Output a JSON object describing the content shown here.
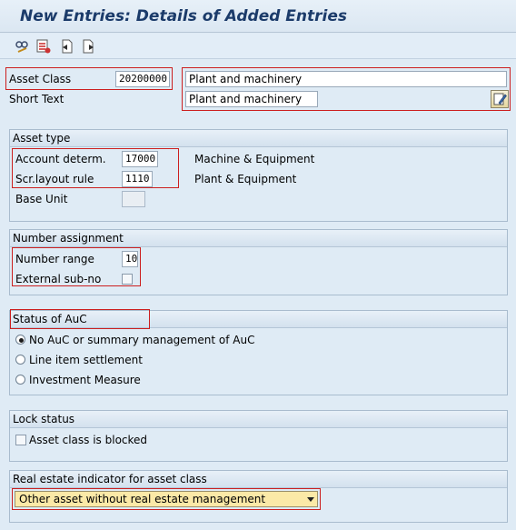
{
  "window": {
    "title": "New Entries: Details of Added Entries"
  },
  "toolbar": {
    "icons": [
      "display-change-icon",
      "delete-icon",
      "previous-entry-icon",
      "next-entry-icon"
    ]
  },
  "header": {
    "asset_class_label": "Asset Class",
    "asset_class_value": "20200000",
    "asset_class_desc": "Plant and machinery",
    "short_text_label": "Short Text",
    "short_text_value": "Plant and machinery"
  },
  "asset_type": {
    "title": "Asset type",
    "account_determ_label": "Account determ.",
    "account_determ_value": "17000",
    "account_determ_desc": "Machine & Equipment",
    "screen_layout_label": "Scr.layout rule",
    "screen_layout_value": "1110",
    "screen_layout_desc": "Plant & Equipment",
    "base_unit_label": "Base Unit",
    "base_unit_value": ""
  },
  "number_assignment": {
    "title": "Number assignment",
    "number_range_label": "Number range",
    "number_range_value": "10",
    "external_subno_label": "External sub-no",
    "external_subno_checked": false
  },
  "status_auc": {
    "title": "Status of AuC",
    "options": [
      {
        "label": "No AuC or summary management of AuC",
        "selected": true
      },
      {
        "label": "Line item settlement",
        "selected": false
      },
      {
        "label": "Investment Measure",
        "selected": false
      }
    ]
  },
  "lock_status": {
    "title": "Lock status",
    "blocked_label": "Asset class is blocked",
    "blocked_checked": false
  },
  "real_estate": {
    "title": "Real estate indicator for asset class",
    "selected": "Other asset without real estate management"
  },
  "colors": {
    "highlight": "#cc1f1f",
    "title": "#1b3b6a",
    "background": "#dfebf5",
    "dropdown": "#fbe9a7"
  }
}
